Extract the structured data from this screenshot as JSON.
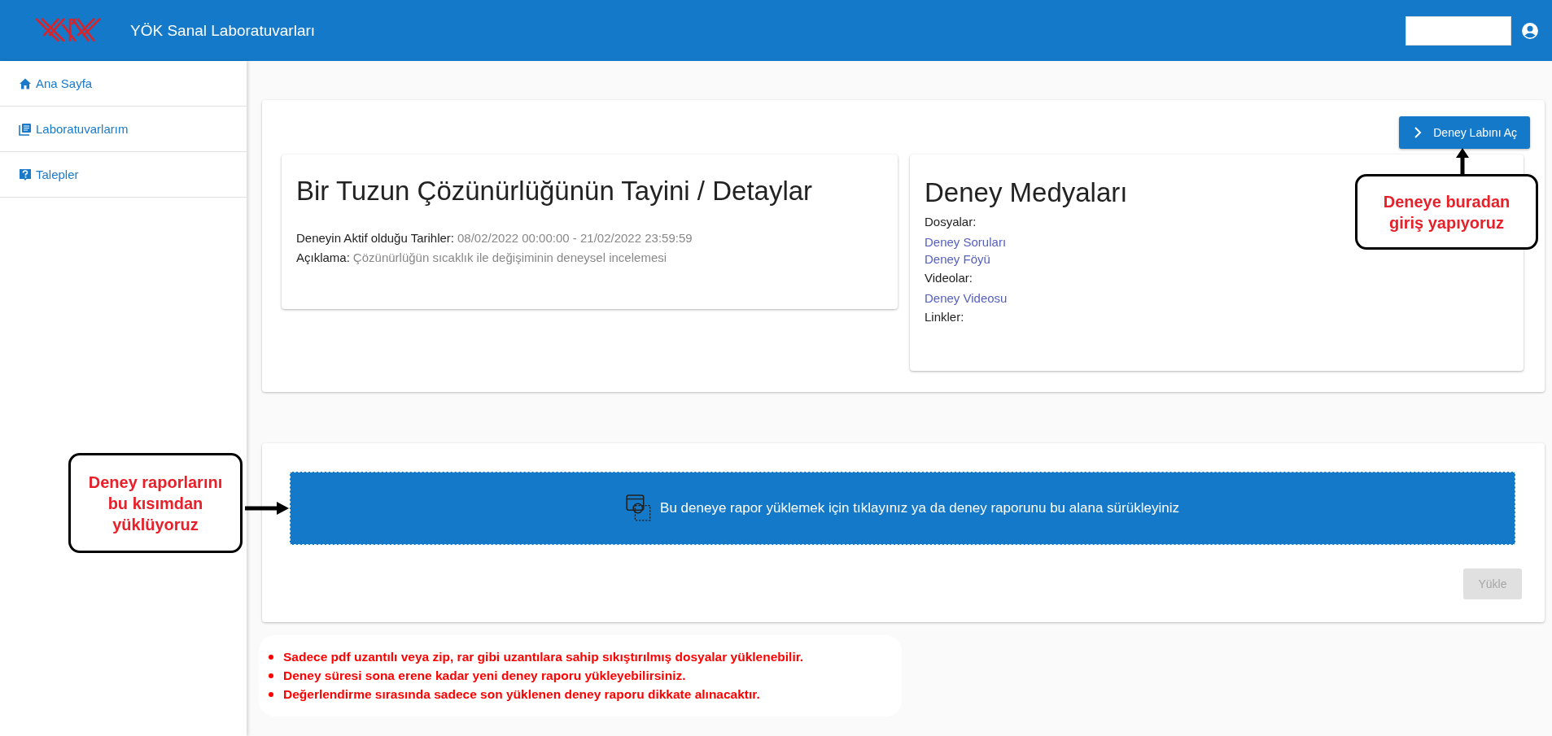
{
  "header": {
    "title": "YÖK Sanal Laboratuvarları"
  },
  "sidebar": {
    "items": [
      {
        "label": "Ana Sayfa",
        "kind": "home"
      },
      {
        "label": "Laboratuvarlarım",
        "kind": "labs"
      },
      {
        "label": "Talepler",
        "kind": "requests"
      }
    ]
  },
  "open_lab_button": "Deney Labını Aç",
  "details": {
    "title": "Bir Tuzun Çözünürlüğünün Tayini / Detaylar",
    "fields": [
      {
        "label": "Deneyin Aktif olduğu Tarihler:",
        "value": "08/02/2022 00:00:00 - 21/02/2022 23:59:59"
      },
      {
        "label": "Açıklama:",
        "value": "Çözünürlüğün sıcaklık ile değişiminin deneysel incelemesi"
      }
    ]
  },
  "media": {
    "title": "Deney Medyaları",
    "groups": [
      {
        "label": "Dosyalar:",
        "links": [
          "Deney Soruları",
          "Deney Föyü"
        ]
      },
      {
        "label": "Videolar:",
        "links": [
          "Deney Videosu"
        ]
      },
      {
        "label": "Linkler:"
      }
    ]
  },
  "upload": {
    "dropzone_text": "Bu deneye rapor yüklemek için tıklayınız ya da deney raporunu bu alana sürükleyiniz",
    "button": {
      "label": "Yükle",
      "disabled": true
    }
  },
  "notes": [
    "Sadece pdf uzantılı veya zip, rar gibi uzantılara sahip sıkıştırılmış dosyalar yüklenebilir.",
    "Deney süresi sona erene kadar yeni deney raporu yükleyebilirsiniz.",
    "Değerlendirme sırasında sadece son yüklenen deney raporu dikkate alınacaktır."
  ],
  "annotations": [
    {
      "kind": "up",
      "lines": [
        "Deneye buradan",
        "giriş yapıyoruz"
      ]
    },
    {
      "kind": "right",
      "lines": [
        "Deney raporlarını",
        "bu kısımdan",
        "yüklüyoruz"
      ]
    }
  ]
}
